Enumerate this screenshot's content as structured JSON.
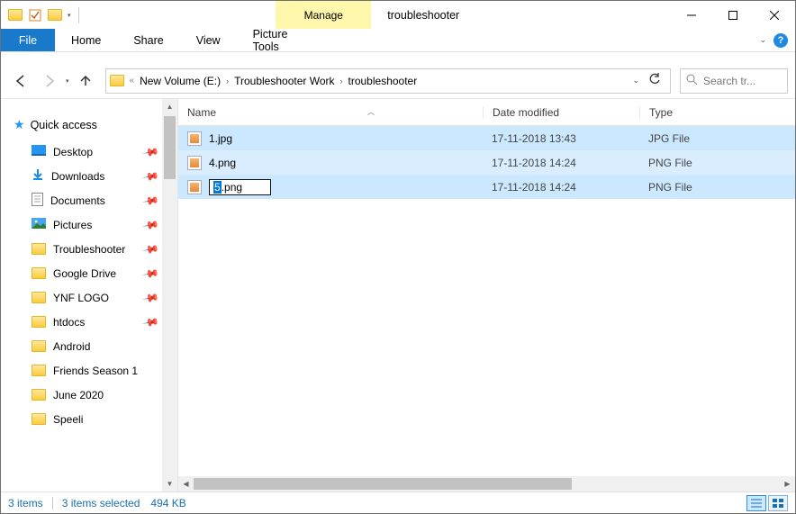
{
  "titlebar": {
    "context_label": "Manage",
    "window_title": "troubleshooter"
  },
  "ribbon": {
    "file": "File",
    "tabs": [
      "Home",
      "Share",
      "View"
    ],
    "context_tab": "Picture Tools"
  },
  "breadcrumb": {
    "items": [
      "New Volume (E:)",
      "Troubleshooter Work",
      "troubleshooter"
    ]
  },
  "search": {
    "placeholder": "Search tr..."
  },
  "sidebar": {
    "quick_access": "Quick access",
    "items": [
      {
        "label": "Desktop",
        "icon": "desktop",
        "pinned": true
      },
      {
        "label": "Downloads",
        "icon": "downloads",
        "pinned": true
      },
      {
        "label": "Documents",
        "icon": "documents",
        "pinned": true
      },
      {
        "label": "Pictures",
        "icon": "pictures",
        "pinned": true
      },
      {
        "label": "Troubleshooter",
        "icon": "folder",
        "pinned": true
      },
      {
        "label": "Google Drive",
        "icon": "folder",
        "pinned": true
      },
      {
        "label": "YNF LOGO",
        "icon": "folder",
        "pinned": true
      },
      {
        "label": "htdocs",
        "icon": "folder",
        "pinned": true
      },
      {
        "label": "Android",
        "icon": "folder",
        "pinned": false
      },
      {
        "label": "Friends Season 1",
        "icon": "folder",
        "pinned": false
      },
      {
        "label": "June 2020",
        "icon": "folder",
        "pinned": false
      },
      {
        "label": "Speeli",
        "icon": "folder",
        "pinned": false
      }
    ]
  },
  "columns": {
    "name": "Name",
    "date": "Date modified",
    "type": "Type"
  },
  "files": [
    {
      "name": "1.jpg",
      "date": "17-11-2018 13:43",
      "type": "JPG File"
    },
    {
      "name": "4.png",
      "date": "17-11-2018 14:24",
      "type": "PNG File"
    },
    {
      "name_sel": "5",
      "name_rest": ".png",
      "date": "17-11-2018 14:24",
      "type": "PNG File",
      "renaming": true
    }
  ],
  "status": {
    "count": "3 items",
    "selection": "3 items selected",
    "size": "494 KB"
  }
}
